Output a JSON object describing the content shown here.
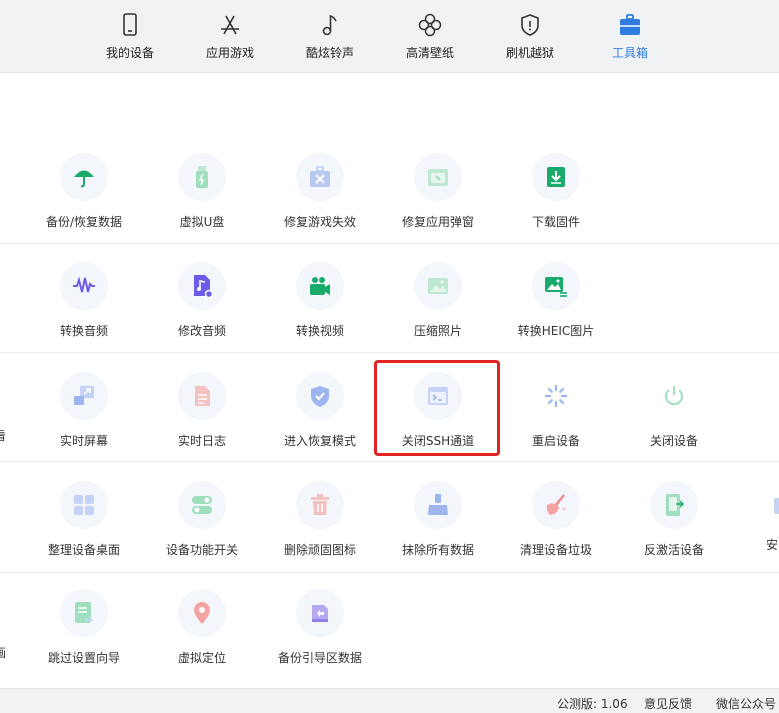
{
  "nav": {
    "tabs": [
      {
        "label": "我的设备",
        "icon": "phone-icon"
      },
      {
        "label": "应用游戏",
        "icon": "app-store-icon"
      },
      {
        "label": "酷炫铃声",
        "icon": "music-note-icon"
      },
      {
        "label": "高清壁纸",
        "icon": "flower-icon"
      },
      {
        "label": "刷机越狱",
        "icon": "shield-icon"
      },
      {
        "label": "工具箱",
        "icon": "toolbox-icon"
      }
    ],
    "active_index": 5
  },
  "tools": {
    "row1": [
      {
        "label": "备份/恢复数据",
        "icon": "umbrella-icon"
      },
      {
        "label": "虚拟U盘",
        "icon": "usb-drive-icon"
      },
      {
        "label": "修复游戏失效",
        "icon": "repair-game-icon"
      },
      {
        "label": "修复应用弹窗",
        "icon": "repair-popup-icon"
      },
      {
        "label": "下载固件",
        "icon": "download-firmware-icon"
      }
    ],
    "row2": [
      {
        "label": "转换音频",
        "icon": "audio-wave-icon"
      },
      {
        "label": "修改音频",
        "icon": "audio-file-icon"
      },
      {
        "label": "转换视频",
        "icon": "video-camera-icon"
      },
      {
        "label": "压缩照片",
        "icon": "photo-icon"
      },
      {
        "label": "转换HEIC图片",
        "icon": "heic-image-icon"
      }
    ],
    "row3": [
      {
        "label": "实时屏幕",
        "icon": "screen-mirror-icon"
      },
      {
        "label": "实时日志",
        "icon": "log-document-icon"
      },
      {
        "label": "进入恢复模式",
        "icon": "shield-check-icon"
      },
      {
        "label": "关闭SSH通道",
        "icon": "terminal-window-icon"
      },
      {
        "label": "重启设备",
        "icon": "restart-spinner-icon"
      },
      {
        "label": "关闭设备",
        "icon": "power-icon"
      }
    ],
    "row3_partial_left": "看",
    "row4": [
      {
        "label": "整理设备桌面",
        "icon": "grid-apps-icon"
      },
      {
        "label": "设备功能开关",
        "icon": "toggle-switch-icon"
      },
      {
        "label": "删除顽固图标",
        "icon": "trash-icon"
      },
      {
        "label": "抹除所有数据",
        "icon": "broom-icon"
      },
      {
        "label": "清理设备垃圾",
        "icon": "cleanup-icon"
      },
      {
        "label": "反激活设备",
        "icon": "deactivate-device-icon"
      }
    ],
    "row4_partial_right": "安",
    "row5": [
      {
        "label": "跳过设置向导",
        "icon": "skip-wizard-icon"
      },
      {
        "label": "虚拟定位",
        "icon": "location-pin-icon"
      },
      {
        "label": "备份引导区数据",
        "icon": "boot-backup-icon"
      }
    ],
    "row5_partial_left": "画"
  },
  "status": {
    "version": "公测版: 1.06",
    "feedback": "意见反馈",
    "wechat": "微信公众号"
  },
  "colors": {
    "accent": "#2f7de1",
    "highlight_border": "#e02424",
    "green": "#1aaa6b",
    "purple": "#6d5ce8"
  }
}
